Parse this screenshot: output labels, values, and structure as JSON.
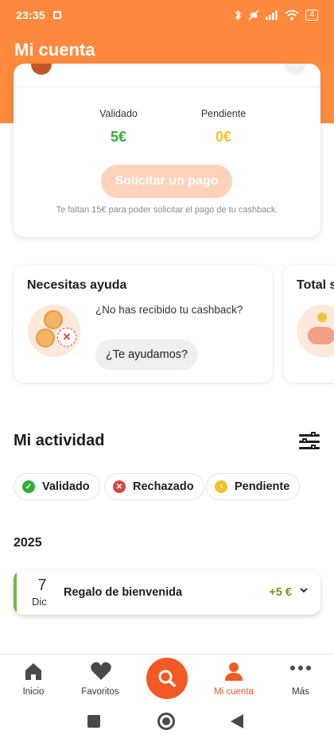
{
  "status_bar": {
    "time": "23:35",
    "battery": "4"
  },
  "header": {
    "title": "Mi cuenta"
  },
  "balance": {
    "validated_label": "Validado",
    "validated_value": "5€",
    "pending_label": "Pendiente",
    "pending_value": "0€",
    "pay_button": "Solicitar un pago",
    "note": "Te faltan 15€ para poder solicitar el pago de tu cashback."
  },
  "help_card": {
    "title": "Necesitas ayuda",
    "question": "¿No has recibido tu cashback?",
    "button": "¿Te ayudamos?"
  },
  "total_card": {
    "title": "Total s"
  },
  "activity": {
    "title": "Mi actividad",
    "filters": [
      {
        "label": "Validado",
        "color": "#2fae3a",
        "icon": "check-icon"
      },
      {
        "label": "Rechazado",
        "color": "#d64545",
        "icon": "x-icon"
      },
      {
        "label": "Pendiente",
        "color": "#f3c12a",
        "icon": "clock-icon"
      }
    ],
    "year": "2025",
    "items": [
      {
        "day": "7",
        "month": "Dic",
        "title": "Regalo de bienvenida",
        "amount": "+5 €"
      }
    ]
  },
  "bottom_nav": {
    "items": [
      {
        "label": "Inicio",
        "icon": "home-icon"
      },
      {
        "label": "Favoritos",
        "icon": "heart-icon"
      },
      {
        "label": "",
        "icon": "search-icon"
      },
      {
        "label": "Mi cuenta",
        "icon": "user-icon",
        "active": true
      },
      {
        "label": "Más",
        "icon": "more-icon"
      }
    ]
  },
  "colors": {
    "brand_orange": "#ff8a3d",
    "accent": "#f15a24",
    "validated_green": "#2fae3a",
    "pending_yellow": "#f3c12a",
    "rejected_red": "#d64545"
  }
}
